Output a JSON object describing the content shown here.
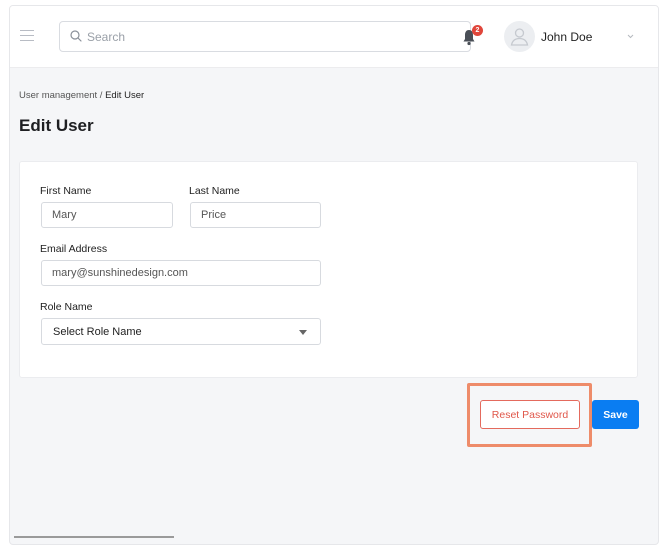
{
  "header": {
    "search_placeholder": "Search",
    "notification_count": "2",
    "user_name": "John Doe"
  },
  "breadcrumb": {
    "parent": "User management",
    "separator": " / ",
    "current": "Edit User"
  },
  "page_title": "Edit User",
  "form": {
    "first_name_label": "First Name",
    "first_name_value": "Mary",
    "last_name_label": "Last Name",
    "last_name_value": "Price",
    "email_label": "Email Address",
    "email_value": "mary@sunshinedesign.com",
    "role_label": "Role Name",
    "role_selected": "Select Role Name"
  },
  "actions": {
    "reset_label": "Reset Password",
    "save_label": "Save"
  },
  "colors": {
    "primary": "#0a7df2",
    "danger": "#e0574a",
    "highlight": "#ee8c6a",
    "badge": "#e0463b"
  }
}
